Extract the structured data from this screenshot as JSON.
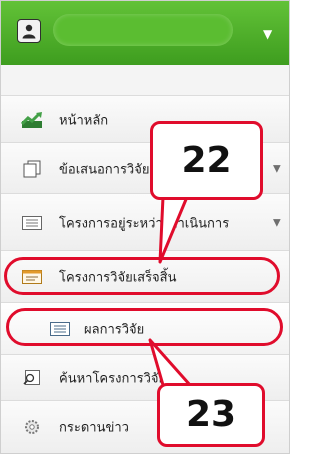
{
  "header": {
    "caret": "▼"
  },
  "menu": [
    {
      "label": "หน้าหลัก",
      "icon": "trend-chart-icon"
    },
    {
      "label": "ข้อเสนอการวิจัย",
      "icon": "documents-icon",
      "caret": "▼"
    },
    {
      "label": "โครงการอยู่ระหว่างดำเนินการ",
      "icon": "list-card-icon",
      "caret": "▼"
    },
    {
      "label": "โครงการวิจัยเสร็จสิ้น",
      "icon": "card-icon"
    },
    {
      "label": "ผลการวิจัย",
      "icon": "list-card-icon"
    },
    {
      "label": "ค้นหาโครงการวิจัย",
      "icon": "search-icon"
    },
    {
      "label": "กระดานข่าว",
      "icon": "gear-icon"
    }
  ],
  "annotations": {
    "callout_top": "22",
    "callout_bottom": "23",
    "color": "#e00c2c"
  }
}
